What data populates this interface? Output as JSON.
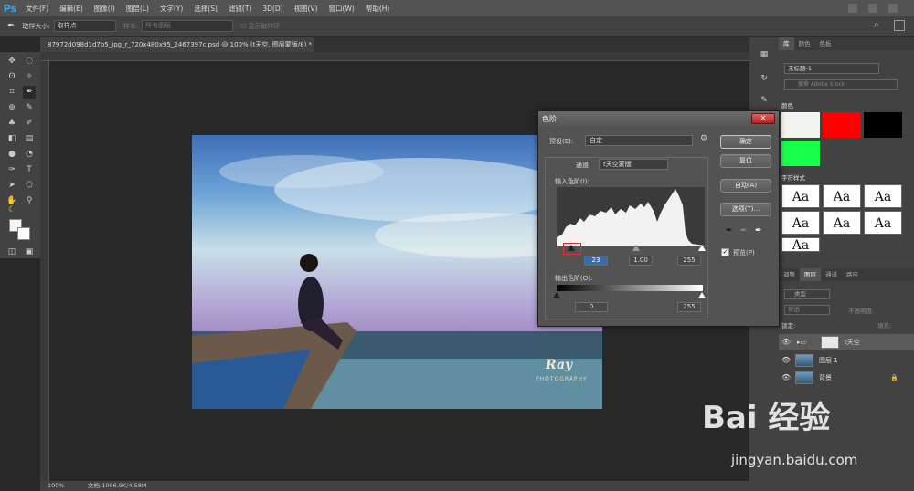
{
  "menubar": {
    "logo": "Ps",
    "items": [
      "文件(F)",
      "编辑(E)",
      "图像(I)",
      "图层(L)",
      "文字(Y)",
      "选择(S)",
      "滤镜(T)",
      "3D(D)",
      "视图(V)",
      "窗口(W)",
      "帮助(H)"
    ]
  },
  "options": {
    "sample_size_label": "取样大小:",
    "sample_size_value": "取样点",
    "sample_label": "样本:",
    "sample_value": "所有图层",
    "show_ring_label": "显示取样环"
  },
  "document": {
    "tab_title": "87972d098d1d7b5_jpg_r_720x480x95_2467397c.psd @ 100% (t天空, 图层蒙版/8) *",
    "zoom": "100%",
    "doc_info": "文档:1006.9K/4.58M"
  },
  "photo": {
    "watermark": "Ray",
    "watermark_sub": "PHOTOGRAPHY"
  },
  "levels_dialog": {
    "title": "色阶",
    "preset_label": "预设(E):",
    "preset_value": "自定",
    "channel_label": "通道:",
    "channel_value": "t天空蒙版",
    "input_levels_label": "输入色阶(I):",
    "input_black": "23",
    "input_gamma": "1.00",
    "input_white": "255",
    "output_levels_label": "输出色阶(O):",
    "output_black": "0",
    "output_white": "255",
    "ok_button": "确定",
    "reset_button": "复位",
    "auto_button": "自动(A)",
    "options_button": "选项(T)...",
    "preview_label": "预览(P)",
    "preview_checked": true
  },
  "library_panel": {
    "tabs": [
      "库",
      "颜色",
      "色板"
    ],
    "library_select": "未标题-1",
    "search_placeholder": "搜索 Adobe Stock",
    "colors_section": "颜色",
    "swatches": [
      "#f2f4f0",
      "#ff0000",
      "#000000",
      "#17ff4a"
    ],
    "char_styles_section": "字符样式",
    "style_text": "Aa"
  },
  "layers_panel": {
    "tabs": [
      "调整",
      "图层",
      "通道",
      "路径"
    ],
    "filter_label": "类型",
    "blend_mode": "穿透",
    "opacity_label": "不透明度:",
    "lock_label": "锁定:",
    "fill_label": "填充:",
    "layers": [
      {
        "name": "t天空"
      },
      {
        "name": "图层 1"
      },
      {
        "name": "背景"
      }
    ]
  },
  "watermark_site": {
    "brand": "Bai 经验",
    "url": "jingyan.baidu.com"
  },
  "colors": {
    "accent": "#31a8ff"
  }
}
